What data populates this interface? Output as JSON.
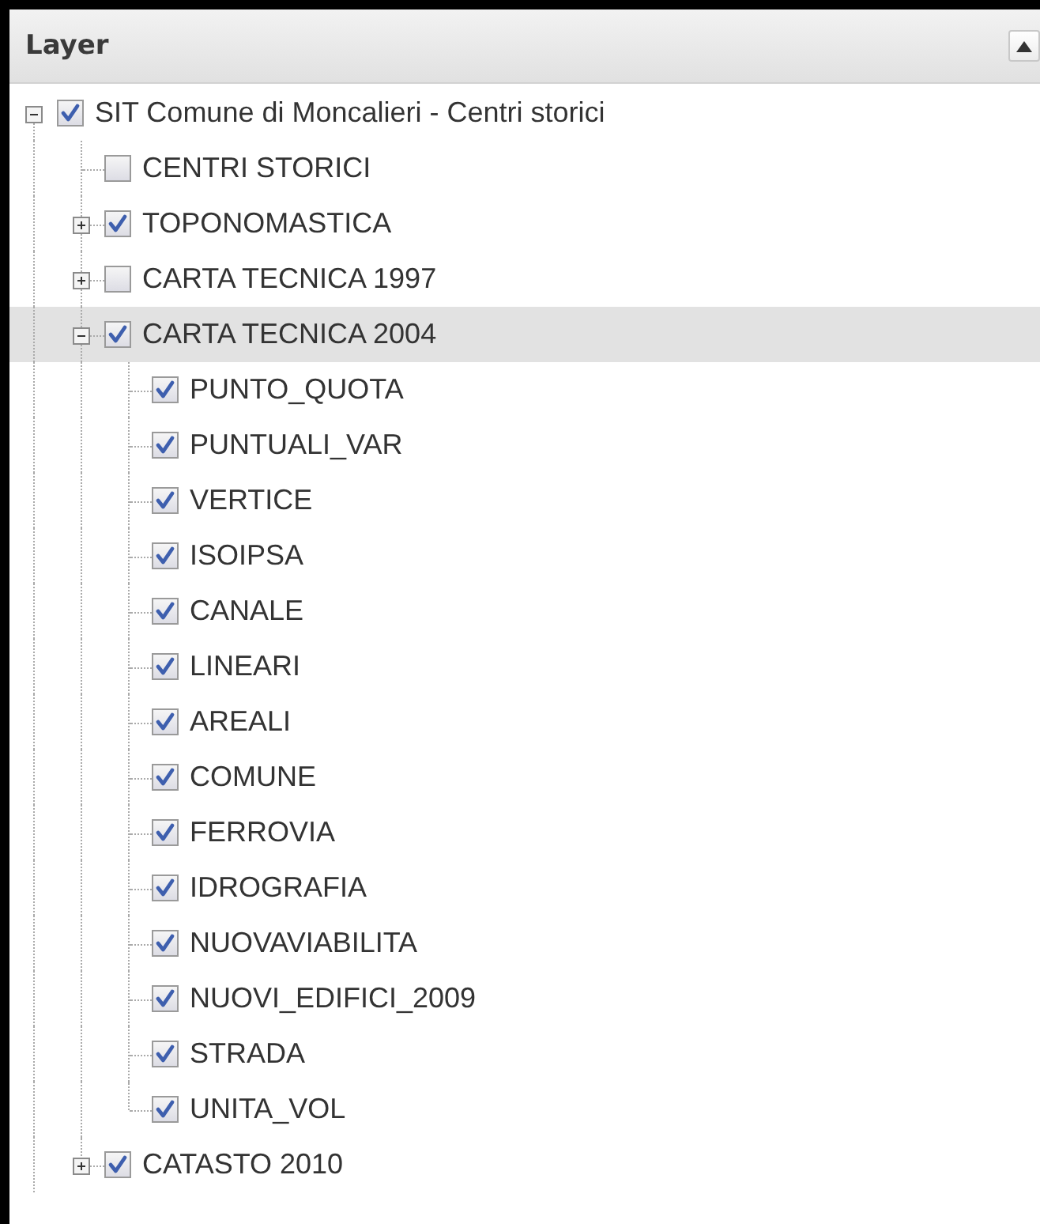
{
  "panel": {
    "title": "Layer"
  },
  "tree": [
    {
      "label": "SIT Comune di Moncalieri - Centri storici",
      "checked": true,
      "expanded": true,
      "selected": false,
      "children": [
        {
          "label": "CENTRI STORICI",
          "checked": false,
          "selected": false
        },
        {
          "label": "TOPONOMASTICA",
          "checked": true,
          "expanded": false,
          "selected": false
        },
        {
          "label": "CARTA TECNICA 1997",
          "checked": false,
          "expanded": false,
          "selected": false
        },
        {
          "label": "CARTA TECNICA 2004",
          "checked": true,
          "expanded": true,
          "selected": true,
          "children": [
            {
              "label": "PUNTO_QUOTA",
              "checked": true,
              "selected": false
            },
            {
              "label": "PUNTUALI_VAR",
              "checked": true,
              "selected": false
            },
            {
              "label": "VERTICE",
              "checked": true,
              "selected": false
            },
            {
              "label": "ISOIPSA",
              "checked": true,
              "selected": false
            },
            {
              "label": "CANALE",
              "checked": true,
              "selected": false
            },
            {
              "label": "LINEARI",
              "checked": true,
              "selected": false
            },
            {
              "label": "AREALI",
              "checked": true,
              "selected": false
            },
            {
              "label": "COMUNE",
              "checked": true,
              "selected": false
            },
            {
              "label": "FERROVIA",
              "checked": true,
              "selected": false
            },
            {
              "label": "IDROGRAFIA",
              "checked": true,
              "selected": false
            },
            {
              "label": "NUOVAVIABILITA",
              "checked": true,
              "selected": false
            },
            {
              "label": "NUOVI_EDIFICI_2009",
              "checked": true,
              "selected": false
            },
            {
              "label": "STRADA",
              "checked": true,
              "selected": false
            },
            {
              "label": "UNITA_VOL",
              "checked": true,
              "selected": false
            }
          ]
        },
        {
          "label": "CATASTO 2010",
          "checked": true,
          "expanded": false,
          "selected": false
        }
      ]
    }
  ]
}
